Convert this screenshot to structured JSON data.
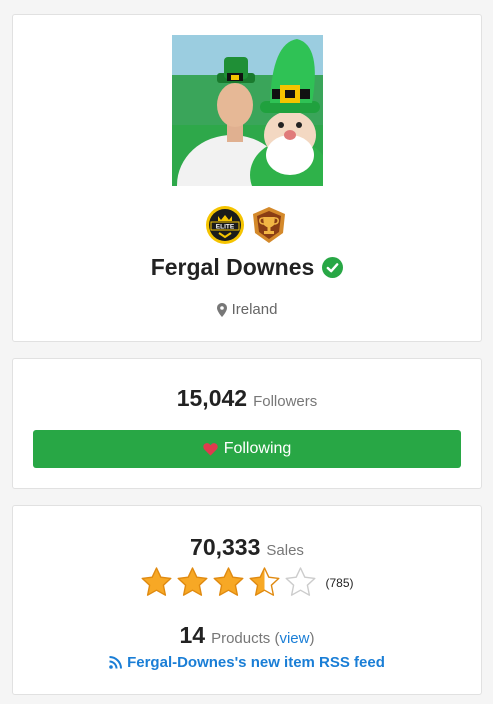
{
  "profile": {
    "avatar_alt": "Fergal Downes profile photo",
    "badges": [
      {
        "name": "elite-badge",
        "text": "ELITE"
      },
      {
        "name": "trophy-badge"
      }
    ],
    "name": "Fergal Downes",
    "verified": true,
    "location": "Ireland"
  },
  "followers": {
    "count": "15,042",
    "label": "Followers",
    "button_label": "Following"
  },
  "sales": {
    "count": "70,333",
    "label": "Sales",
    "rating": 3.5,
    "rating_max": 5,
    "rating_count": "(785)",
    "products_count": "14",
    "products_label": "Products",
    "products_open": "(",
    "products_link": "view",
    "products_close": ")",
    "rss_label": "Fergal-Downes's new item RSS feed"
  },
  "colors": {
    "accent_green": "#28a745",
    "verified_green": "#28a745",
    "link_blue": "#1a7ed6",
    "star_gold": "#f7b733"
  }
}
